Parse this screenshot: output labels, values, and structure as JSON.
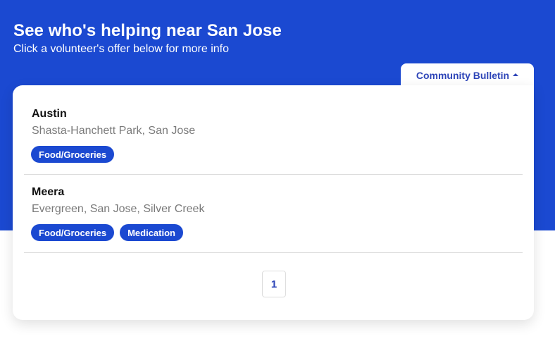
{
  "header": {
    "title": "See who's helping near San Jose",
    "subtitle": "Click a volunteer's offer below for more info"
  },
  "bulletin_tab": {
    "label": "Community Bulletin",
    "icon": "caret-up-icon"
  },
  "offers": [
    {
      "name": "Austin",
      "location": "Shasta-Hanchett Park, San Jose",
      "tags": [
        "Food/Groceries"
      ]
    },
    {
      "name": "Meera",
      "location": "Evergreen, San Jose, Silver Creek",
      "tags": [
        "Food/Groceries",
        "Medication"
      ]
    }
  ],
  "pagination": {
    "current_page": "1"
  },
  "colors": {
    "brand_blue": "#1b49d1",
    "link_blue": "#2e45b8",
    "muted_text": "#7a7a7a"
  }
}
